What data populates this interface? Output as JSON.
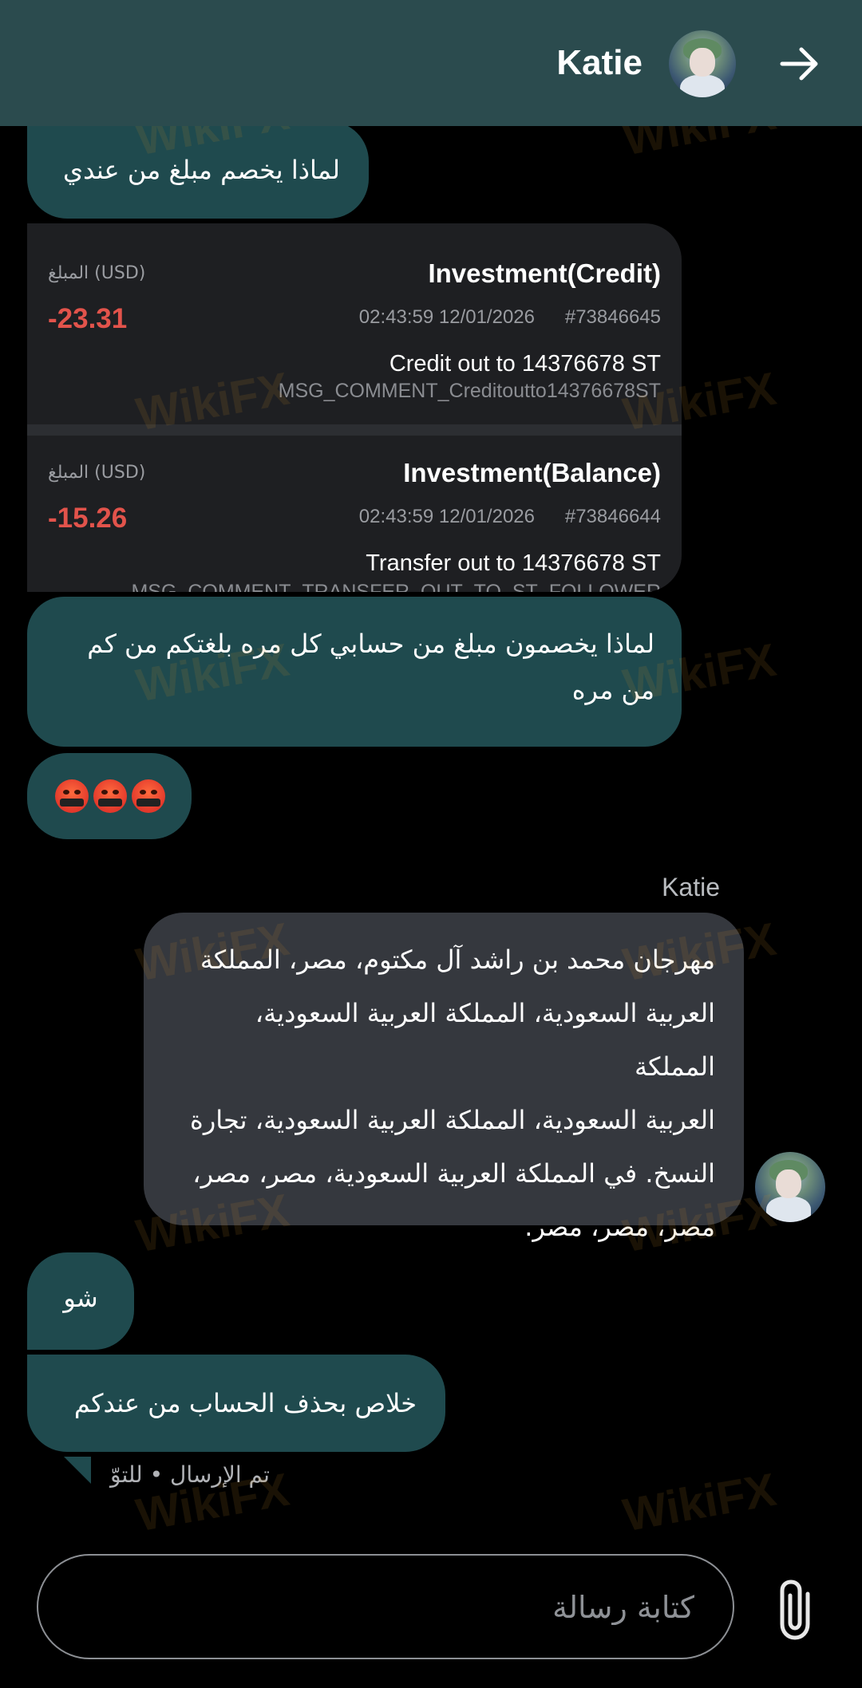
{
  "header": {
    "title": "Katie"
  },
  "messages": {
    "m1": "لماذا يخصم مبلغ من عندي",
    "m3_line1": "لماذا يخصمون مبلغ من حسابي كل مره بلغتكم من كم",
    "m3_line2": "من مره",
    "sender_name": "Katie",
    "reply_lines": [
      "مهرجان محمد بن راشد آل مكتوم، مصر، المملكة",
      "العربية السعودية، المملكة العربية السعودية، المملكة",
      "العربية السعودية، المملكة العربية السعودية، تجارة",
      "النسخ. في المملكة العربية السعودية، مصر، مصر،",
      "مصر، مصر، مصر."
    ],
    "m5": "شو",
    "m6": "خلاص بحذف الحساب من عندكم",
    "status": "تم الإرسال • للتوّ"
  },
  "transactions": [
    {
      "title": "Investment(Credit)",
      "id": "#73846645",
      "date": "02:43:59 12/01/2026",
      "description": "Credit out to 14376678 ST",
      "comment": "MSG_COMMENT_Creditoutto14376678ST",
      "amount_label": "المبلغ (USD)",
      "amount": "-23.31"
    },
    {
      "title": "Investment(Balance)",
      "id": "#73846644",
      "date": "02:43:59 12/01/2026",
      "description": "Transfer out to 14376678 ST",
      "comment": "MSG_COMMENT_TRANSFER_OUT_TO_ST_FOLLOWER",
      "amount_label": "المبلغ (USD)",
      "amount": "-15.26"
    }
  ],
  "composer": {
    "placeholder": "كتابة رسالة"
  },
  "icons": {
    "back": "arrow-right-icon",
    "attach": "paperclip-icon",
    "emoji": "face-with-symbols-on-mouth-icon"
  },
  "watermark": "WikiFX",
  "colors": {
    "header_bg": "#2b4b4e",
    "sent_bubble": "#1f4a4e",
    "received_bubble": "#35383e",
    "negative_amount": "#e2534b"
  }
}
